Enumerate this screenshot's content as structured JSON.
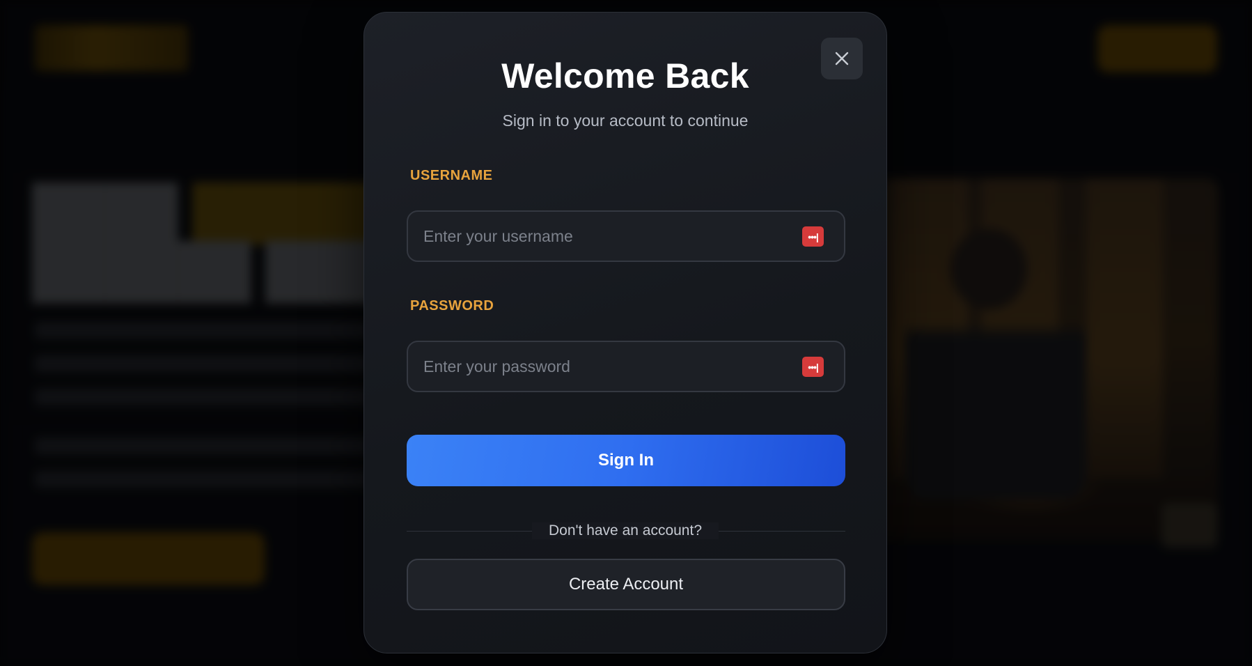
{
  "modal": {
    "title": "Welcome Back",
    "subtitle": "Sign in to your account to continue",
    "close_icon": "close-icon",
    "username": {
      "label": "USERNAME",
      "placeholder": "Enter your username",
      "value": ""
    },
    "password": {
      "label": "PASSWORD",
      "placeholder": "Enter your password",
      "value": ""
    },
    "password_manager_icon": "password-manager-icon",
    "sign_in_label": "Sign In",
    "divider_text": "Don't have an account?",
    "create_account_label": "Create Account"
  },
  "colors": {
    "accent_label": "#e8a33d",
    "primary_button": "#3b82f6",
    "modal_background": "#1a1d23",
    "password_manager_badge": "#d63b3b"
  }
}
